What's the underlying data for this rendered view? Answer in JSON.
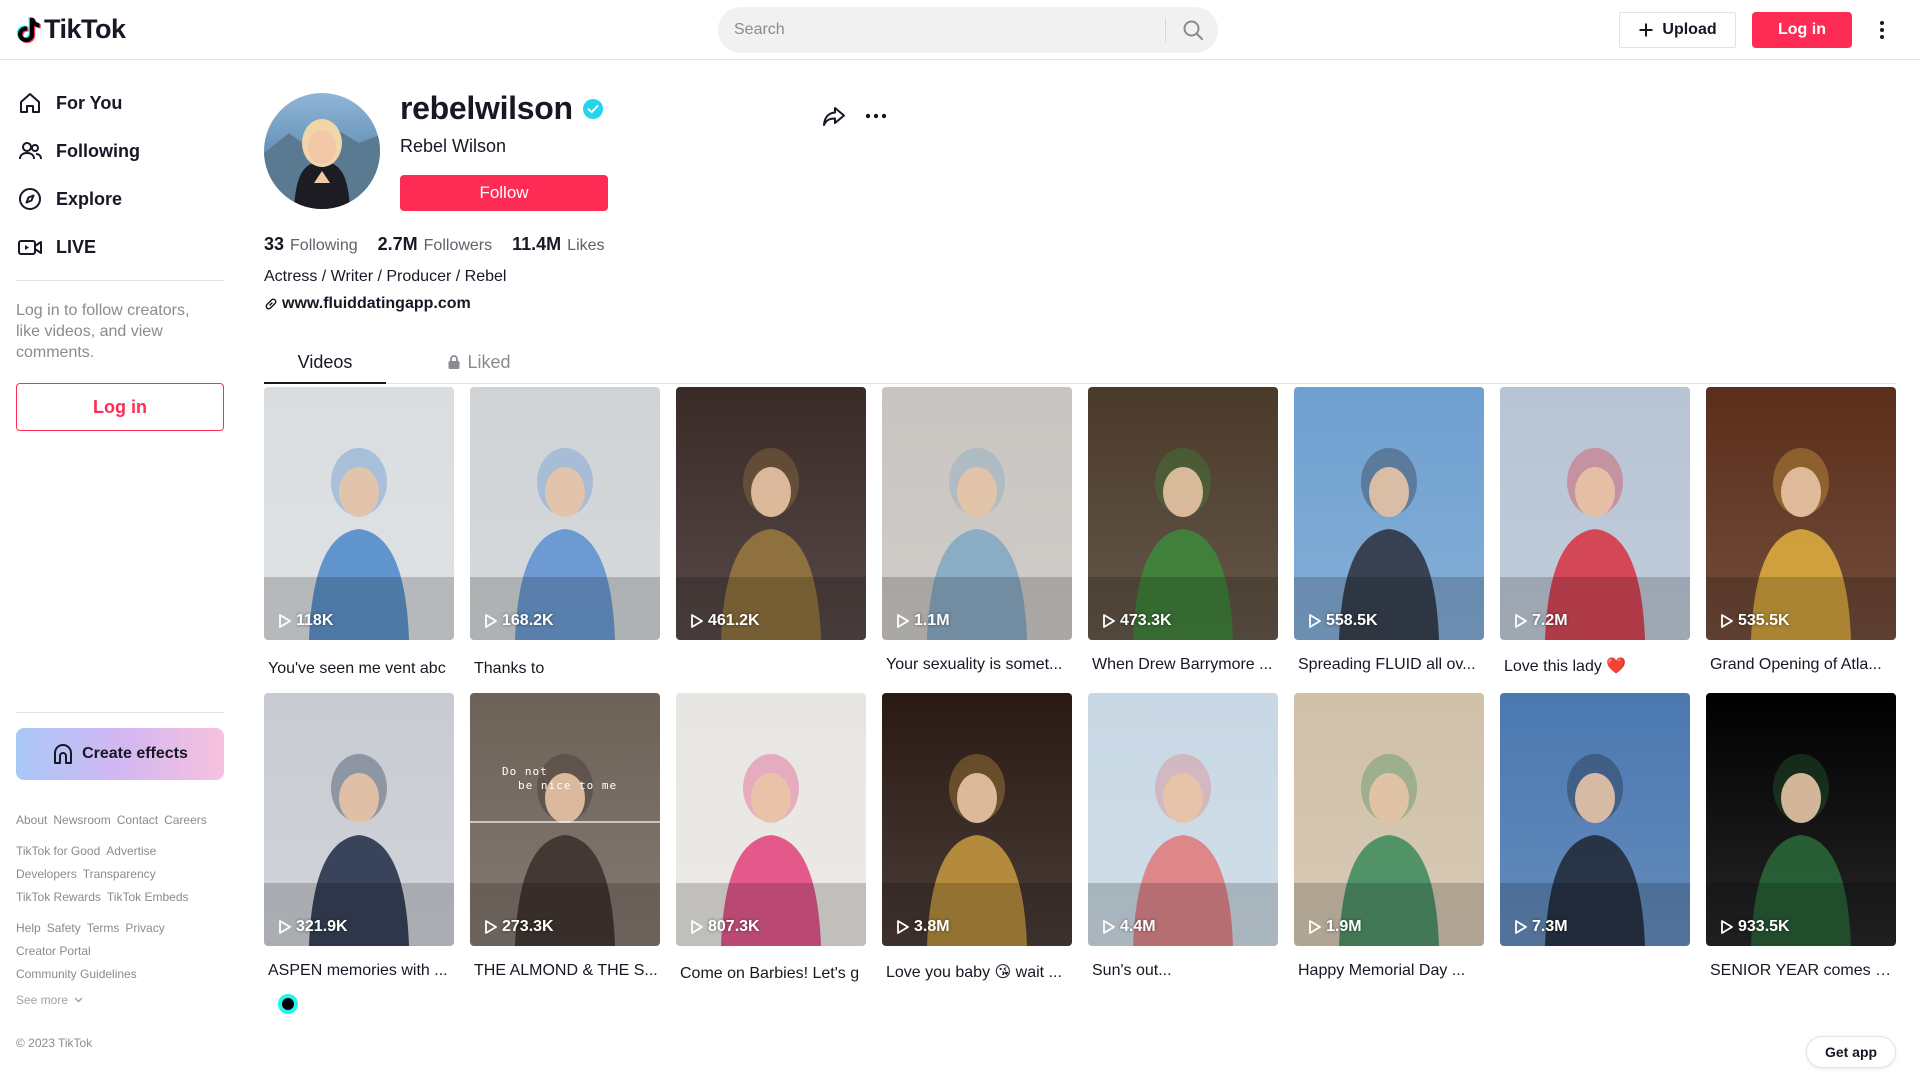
{
  "header": {
    "logo_text": "TikTok",
    "search_placeholder": "Search",
    "upload_label": "Upload",
    "login_label": "Log in"
  },
  "sidebar": {
    "nav": [
      {
        "label": "For You",
        "icon": "home-icon"
      },
      {
        "label": "Following",
        "icon": "users-icon"
      },
      {
        "label": "Explore",
        "icon": "compass-icon"
      },
      {
        "label": "LIVE",
        "icon": "live-icon"
      }
    ],
    "login_prompt": "Log in to follow creators, like videos, and view comments.",
    "login_button": "Log in",
    "create_effects": "Create effects",
    "footer_links": [
      [
        "About",
        "Newsroom",
        "Contact",
        "Careers"
      ],
      [
        "TikTok for Good",
        "Advertise"
      ],
      [
        "Developers",
        "Transparency"
      ],
      [
        "TikTok Rewards",
        "TikTok Embeds"
      ],
      [
        "Help",
        "Safety",
        "Terms",
        "Privacy"
      ],
      [
        "Creator Portal"
      ],
      [
        "Community Guidelines"
      ]
    ],
    "see_more": "See more",
    "copyright": "© 2023 TikTok"
  },
  "profile": {
    "username": "rebelwilson",
    "nickname": "Rebel Wilson",
    "follow_label": "Follow",
    "stats": [
      {
        "value": "33",
        "label": "Following"
      },
      {
        "value": "2.7M",
        "label": "Followers"
      },
      {
        "value": "11.4M",
        "label": "Likes"
      }
    ],
    "bio": "Actress / Writer / Producer / Rebel",
    "link": "www.fluiddatingapp.com"
  },
  "tabs": {
    "videos": "Videos",
    "liked": "Liked"
  },
  "videos": [
    {
      "views": "118K",
      "caption": "You've seen me vent abc",
      "colors": [
        "#d9dde0",
        "#4a86c8"
      ]
    },
    {
      "views": "168.2K",
      "caption": "Thanks to",
      "colors": [
        "#cfd3d6",
        "#5a8fd0"
      ]
    },
    {
      "views": "461.2K",
      "caption": "",
      "colors": [
        "#3a2a28",
        "#9a7a40"
      ]
    },
    {
      "views": "1.1M",
      "caption": "Your sexuality is somet...",
      "colors": [
        "#c8c4c0",
        "#7fa7c4"
      ]
    },
    {
      "views": "473.3K",
      "caption": "When Drew Barrymore ...",
      "colors": [
        "#4a3a2a",
        "#3c8a3a"
      ]
    },
    {
      "views": "558.5K",
      "caption": "Spreading FLUID all ov...",
      "colors": [
        "#6fa0d0",
        "#2c2f3a"
      ]
    },
    {
      "views": "7.2M",
      "caption": "Love this lady ❤️",
      "colors": [
        "#b7c4d4",
        "#d83040"
      ]
    },
    {
      "views": "535.5K",
      "caption": "Grand Opening of Atla...",
      "colors": [
        "#5a2e1a",
        "#e0b040"
      ]
    },
    {
      "views": "321.9K",
      "caption": "ASPEN memories with ...",
      "colors": [
        "#c8ccd2",
        "#1e2a44"
      ]
    },
    {
      "views": "273.3K",
      "caption": "THE ALMOND & THE S...",
      "colors": [
        "#6e6258",
        "#3a2e2a"
      ]
    },
    {
      "views": "807.3K",
      "caption": "Come on Barbies! Let's g",
      "colors": [
        "#e8e6e2",
        "#e0407a"
      ]
    },
    {
      "views": "3.8M",
      "caption": "Love you baby 😘 wait ...",
      "colors": [
        "#2a1a14",
        "#c89a40"
      ]
    },
    {
      "views": "4.4M",
      "caption": "Sun's out...",
      "colors": [
        "#c8d8e4",
        "#e0787a"
      ]
    },
    {
      "views": "1.9M",
      "caption": "Happy Memorial Day ...",
      "colors": [
        "#d0c0a8",
        "#3a8a5a"
      ]
    },
    {
      "views": "7.3M",
      "caption": "",
      "colors": [
        "#4a78b0",
        "#1e2632"
      ]
    },
    {
      "views": "933.5K",
      "caption": "SENIOR YEAR comes o...",
      "colors": [
        "#000000",
        "#2a6a3a"
      ]
    }
  ],
  "thumb_text_1": "Do not",
  "thumb_text_2": "be nice to me",
  "get_app": "Get app"
}
